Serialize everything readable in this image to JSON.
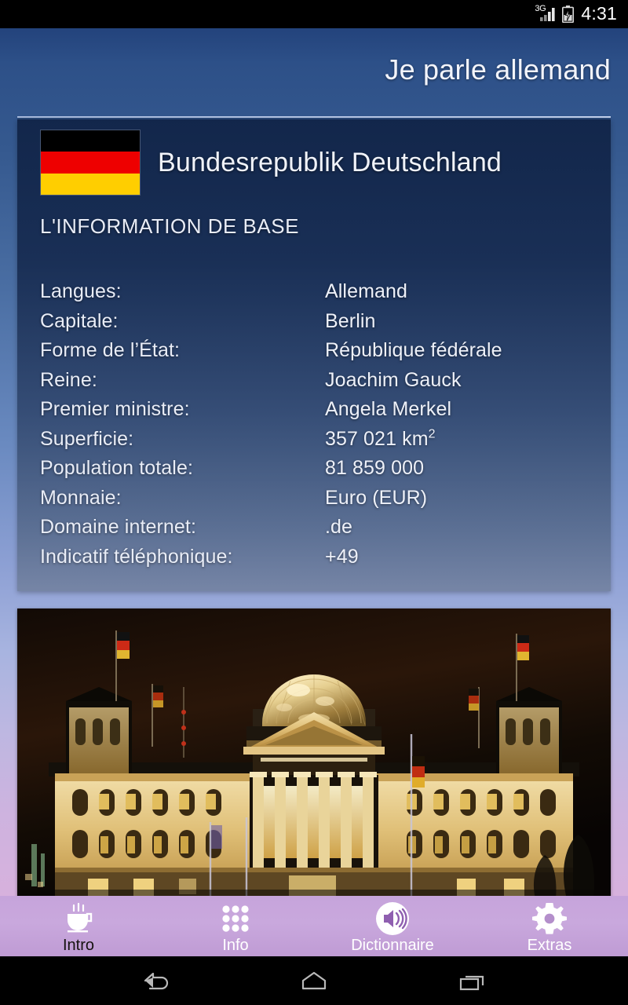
{
  "status_bar": {
    "network_label": "3G",
    "signal_icon": "signal-bars-icon",
    "battery_icon": "battery-charging-icon",
    "time": "4:31"
  },
  "header": {
    "app_title": "Je parle allemand"
  },
  "card": {
    "flag_icon": "germany-flag-icon",
    "flag_colors": [
      "#000000",
      "#EE0000",
      "#FFCE00"
    ],
    "country_name": "Bundesrepublik Deutschland",
    "section_title": "L'INFORMATION DE BASE",
    "rows": [
      {
        "label": "Langues:",
        "value": "Allemand"
      },
      {
        "label": "Capitale:",
        "value": "Berlin"
      },
      {
        "label": "Forme de l’État:",
        "value": "République fédérale"
      },
      {
        "label": "Reine:",
        "value": "Joachim Gauck"
      },
      {
        "label": "Premier ministre:",
        "value": "Angela Merkel"
      },
      {
        "label": "Superficie:",
        "value": "357 021 km",
        "sup": "2"
      },
      {
        "label": "Population totale:",
        "value": "81 859 000"
      },
      {
        "label": "Monnaie:",
        "value": "Euro (EUR)"
      },
      {
        "label": "Domaine internet:",
        "value": ".de"
      },
      {
        "label": "Indicatif téléphonique:",
        "value": "+49"
      }
    ]
  },
  "photo": {
    "name": "reichstag-building-night-photo",
    "alt": "Reichstag building in Berlin illuminated at night"
  },
  "tabbar": {
    "accent_color": "#C9A8DD",
    "tabs": [
      {
        "label": "Intro",
        "icon": "coffee-cup-icon",
        "active": true
      },
      {
        "label": "Info",
        "icon": "grid-dots-icon",
        "active": false
      },
      {
        "label": "Dictionnaire",
        "icon": "speaker-sound-icon",
        "active": false
      },
      {
        "label": "Extras",
        "icon": "gear-icon",
        "active": false
      }
    ]
  },
  "navbar": {
    "buttons": [
      {
        "name": "back-button",
        "icon": "back-arrow-icon"
      },
      {
        "name": "home-button",
        "icon": "home-icon"
      },
      {
        "name": "recents-button",
        "icon": "recent-apps-icon"
      }
    ]
  }
}
